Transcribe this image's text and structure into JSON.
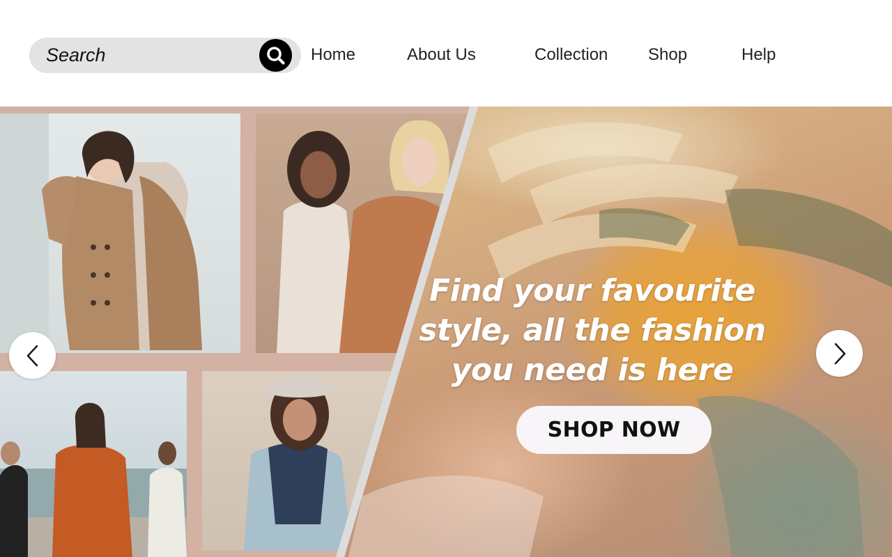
{
  "search": {
    "placeholder": "Search",
    "icon": "search-icon"
  },
  "nav": {
    "items": [
      {
        "label": "Home"
      },
      {
        "label": "About Us"
      },
      {
        "label": "Collection"
      },
      {
        "label": "Shop"
      },
      {
        "label": "Help"
      }
    ]
  },
  "hero": {
    "headline_lines": [
      "Find your favourite",
      "style, all the fashion",
      "you need is here"
    ],
    "cta_label": "SHOP NOW",
    "prev_icon": "chevron-left-icon",
    "next_icon": "chevron-right-icon",
    "photos": [
      "woman-in-trench-coat-photo",
      "two-women-in-coats-photo",
      "group-by-the-sea-photo",
      "woman-in-hat-photo",
      "clothes-on-hangers-photo"
    ]
  },
  "colors": {
    "search_bg": "#e3e3e3",
    "collage_bg": "#d3b1a3",
    "accent_dark": "#000000",
    "button_bg": "#f7f5f8",
    "headline_text": "#ffffff"
  }
}
